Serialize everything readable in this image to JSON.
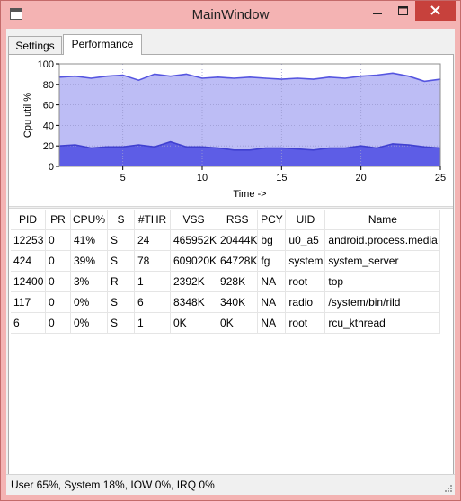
{
  "window": {
    "title": "MainWindow"
  },
  "tabs": [
    {
      "label": "Settings",
      "active": false
    },
    {
      "label": "Performance",
      "active": true
    }
  ],
  "chart_data": {
    "type": "area",
    "xlabel": "Time ->",
    "ylabel": "Cpu util %",
    "xlim": [
      1,
      25
    ],
    "ylim": [
      0,
      100
    ],
    "xticks": [
      5,
      10,
      15,
      20,
      25
    ],
    "yticks": [
      0,
      20,
      40,
      60,
      80,
      100
    ],
    "grid": true,
    "x": [
      1,
      2,
      3,
      4,
      5,
      6,
      7,
      8,
      9,
      10,
      11,
      12,
      13,
      14,
      15,
      16,
      17,
      18,
      19,
      20,
      21,
      22,
      23,
      24,
      25
    ],
    "series": [
      {
        "values": [
          87,
          88,
          86,
          88,
          89,
          84,
          90,
          88,
          90,
          86,
          87,
          86,
          87,
          86,
          85,
          86,
          85,
          87,
          86,
          88,
          89,
          91,
          88,
          83,
          85
        ],
        "color": "#5555e0",
        "fill": "#bdbdf5"
      },
      {
        "values": [
          20,
          21,
          18,
          19,
          19,
          21,
          19,
          24,
          19,
          19,
          18,
          16,
          16,
          18,
          18,
          17,
          16,
          18,
          18,
          20,
          18,
          22,
          21,
          19,
          18
        ],
        "color": "#4040d0",
        "fill": "#5d5de6"
      }
    ]
  },
  "process_table": {
    "columns": [
      "PID",
      "PR",
      "CPU%",
      "S",
      "#THR",
      "VSS",
      "RSS",
      "PCY",
      "UID",
      "Name"
    ],
    "rows": [
      [
        "12253",
        "0",
        "41%",
        "S",
        "24",
        "465952K",
        "20444K",
        "bg",
        "u0_a5",
        "android.process.media"
      ],
      [
        "424",
        "0",
        "39%",
        "S",
        "78",
        "609020K",
        "64728K",
        "fg",
        "system",
        "system_server"
      ],
      [
        "12400",
        "0",
        "3%",
        "R",
        "1",
        "2392K",
        "928K",
        "NA",
        "root",
        "top"
      ],
      [
        "117",
        "0",
        "0%",
        "S",
        "6",
        "8348K",
        "340K",
        "NA",
        "radio",
        "/system/bin/rild"
      ],
      [
        "6",
        "0",
        "0%",
        "S",
        "1",
        "0K",
        "0K",
        "NA",
        "root",
        "rcu_kthread"
      ]
    ]
  },
  "status": {
    "text": "User 65%, System 18%, IOW 0%, IRQ 0%"
  },
  "icons": {
    "minimize": "minimize-icon",
    "maximize": "maximize-icon",
    "close": "close-icon",
    "app": "window-icon",
    "grip": "size-grip-icon"
  }
}
